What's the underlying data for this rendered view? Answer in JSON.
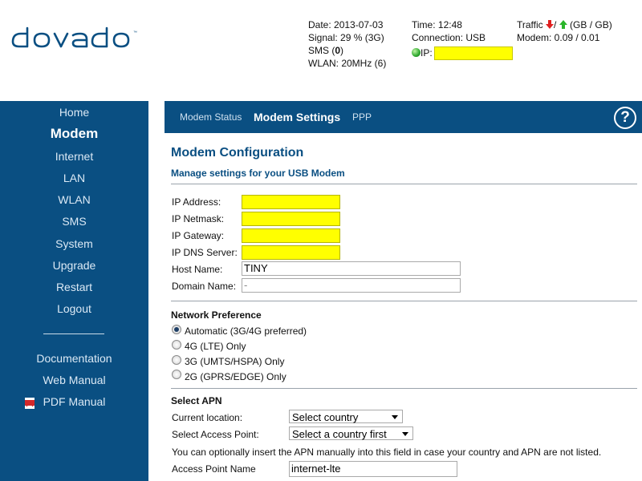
{
  "brand": {
    "logo_text": "dovado"
  },
  "status": {
    "date": "Date: 2013-07-03",
    "signal": "Signal: 29 % (3G)",
    "sms_prefix": "SMS (",
    "sms_count": "0",
    "sms_suffix": ")",
    "wlan": "WLAN: 20MHz (6)",
    "time": "Time: 12:48",
    "connection": "Connection: USB",
    "ip_label": "IP:",
    "ip_value": "",
    "traffic_prefix": "Traffic",
    "traffic_sep": "/",
    "traffic_unit": "(GB / GB)",
    "modem_traffic": "Modem: 0.09 / 0.01"
  },
  "sidebar": {
    "items": [
      {
        "label": "Home"
      },
      {
        "label": "Modem",
        "active": true
      },
      {
        "label": "Internet"
      },
      {
        "label": "LAN"
      },
      {
        "label": "WLAN"
      },
      {
        "label": "SMS"
      },
      {
        "label": "System"
      },
      {
        "label": "Upgrade"
      },
      {
        "label": "Restart"
      },
      {
        "label": "Logout"
      }
    ],
    "docs": [
      {
        "label": "Documentation"
      },
      {
        "label": "Web Manual"
      },
      {
        "label": "PDF Manual"
      }
    ]
  },
  "tabs": [
    {
      "label": "Modem Status"
    },
    {
      "label": "Modem Settings",
      "active": true
    },
    {
      "label": "PPP"
    }
  ],
  "help": {
    "label": "?"
  },
  "page": {
    "title": "Modem Configuration",
    "subtitle": "Manage settings for your USB Modem"
  },
  "fields": {
    "ip_address": {
      "label": "IP Address:",
      "value": ""
    },
    "ip_netmask": {
      "label": "IP Netmask:",
      "value": ""
    },
    "ip_gateway": {
      "label": "IP Gateway:",
      "value": ""
    },
    "ip_dns": {
      "label": "IP DNS Server:",
      "value": ""
    },
    "host_name": {
      "label": "Host Name:",
      "value": "TINY"
    },
    "domain_name": {
      "label": "Domain Name:",
      "value": "-"
    }
  },
  "network_preference": {
    "title": "Network Preference",
    "options": [
      {
        "label": "Automatic (3G/4G preferred)",
        "checked": true
      },
      {
        "label": "4G (LTE) Only",
        "checked": false
      },
      {
        "label": "3G (UMTS/HSPA) Only",
        "checked": false
      },
      {
        "label": "2G (GPRS/EDGE) Only",
        "checked": false
      }
    ]
  },
  "apn": {
    "title": "Select APN",
    "location_label": "Current location:",
    "location_value": "Select country",
    "access_point_label": "Select Access Point:",
    "access_point_value": "Select a country first",
    "note": "You can optionally insert the APN manually into this field in case your country and APN are not listed.",
    "apn_name_label": "Access Point Name",
    "apn_name_value": "internet-lte"
  },
  "colors": {
    "nav": "#0a4f82",
    "highlight": "#ffff00",
    "heading": "#0a4f82"
  },
  "icons": [
    "dovado-logo",
    "arrow-down-icon",
    "arrow-up-icon",
    "globe-icon",
    "help-icon",
    "pdf-icon",
    "radio-icon",
    "chevron-down-icon"
  ]
}
